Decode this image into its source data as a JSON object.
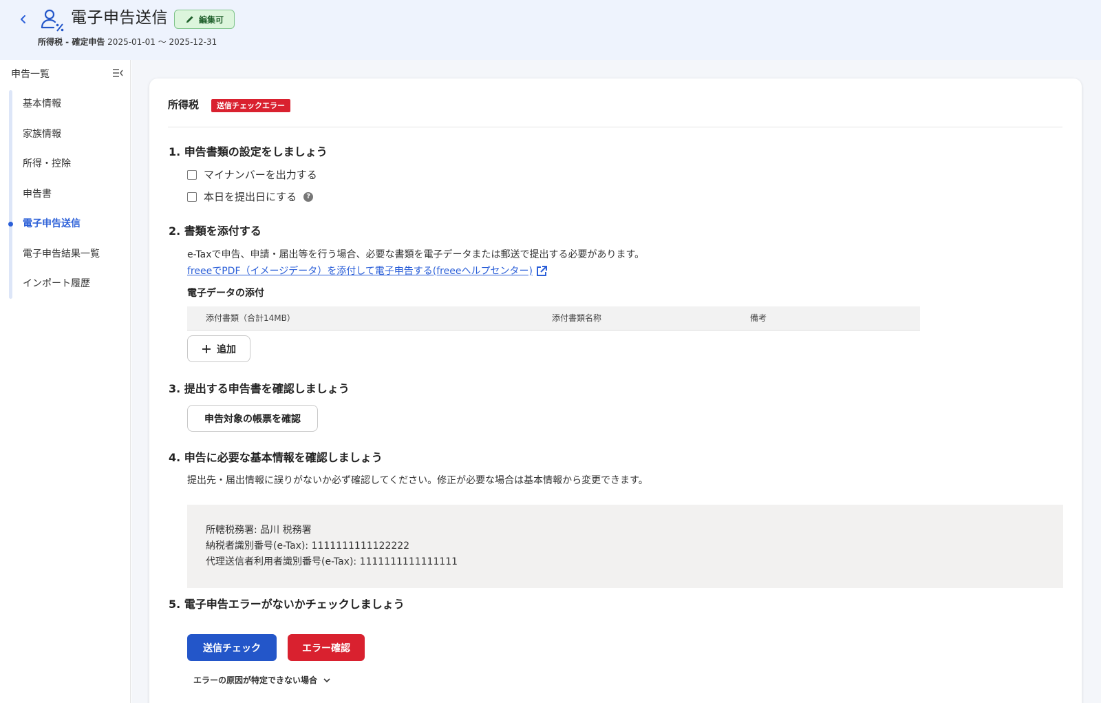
{
  "header": {
    "title": "電子申告送信",
    "edit_badge": "編集可",
    "subtitle_bold": "所得税 - 確定申告",
    "subtitle_period": "2025-01-01 ～ 2025-12-31"
  },
  "sidebar": {
    "heading": "申告一覧",
    "items": [
      {
        "label": "基本情報",
        "active": false
      },
      {
        "label": "家族情報",
        "active": false
      },
      {
        "label": "所得・控除",
        "active": false
      },
      {
        "label": "申告書",
        "active": false
      },
      {
        "label": "電子申告送信",
        "active": true
      },
      {
        "label": "電子申告結果一覧",
        "active": false
      },
      {
        "label": "インポート履歴",
        "active": false
      }
    ]
  },
  "card": {
    "title": "所得税",
    "error_badge": "送信チェックエラー",
    "section1": {
      "title": "1. 申告書類の設定をしましょう",
      "checkbox_mynumber": "マイナンバーを出力する",
      "checkbox_today": "本日を提出日にする"
    },
    "section2": {
      "title": "2. 書類を添付する",
      "description": "e-Taxで申告、申請・届出等を行う場合、必要な書類を電子データまたは郵送で提出する必要があります。",
      "link": "freeeでPDF（イメージデータ）を添付して電子申告する(freeeヘルプセンター)",
      "subheading": "電子データの添付",
      "columns": [
        "添付書類（合計14MB）",
        "添付書類名称",
        "備考"
      ],
      "add_button": "追加"
    },
    "section3": {
      "title": "3. 提出する申告書を確認しましょう",
      "button": "申告対象の帳票を確認"
    },
    "section4": {
      "title": "4. 申告に必要な基本情報を確認しましょう",
      "description": "提出先・届出情報に誤りがないか必ず確認してください。修正が必要な場合は基本情報から変更できます。",
      "tax_office": "所轄税務署: 品川 税務署",
      "taxpayer_id": "納税者識別番号(e-Tax): 1111111111122222",
      "agent_id": "代理送信者利用者識別番号(e-Tax): 1111111111111111"
    },
    "section5": {
      "title": "5. 電子申告エラーがないかチェックしましょう",
      "check_button": "送信チェック",
      "error_button": "エラー確認",
      "expander": "エラーの原因が特定できない場合"
    }
  },
  "colors": {
    "header_bg": "#eef3fd",
    "accent": "#2356c9",
    "danger": "#d9212f",
    "active_nav": "#2b5fd8"
  }
}
